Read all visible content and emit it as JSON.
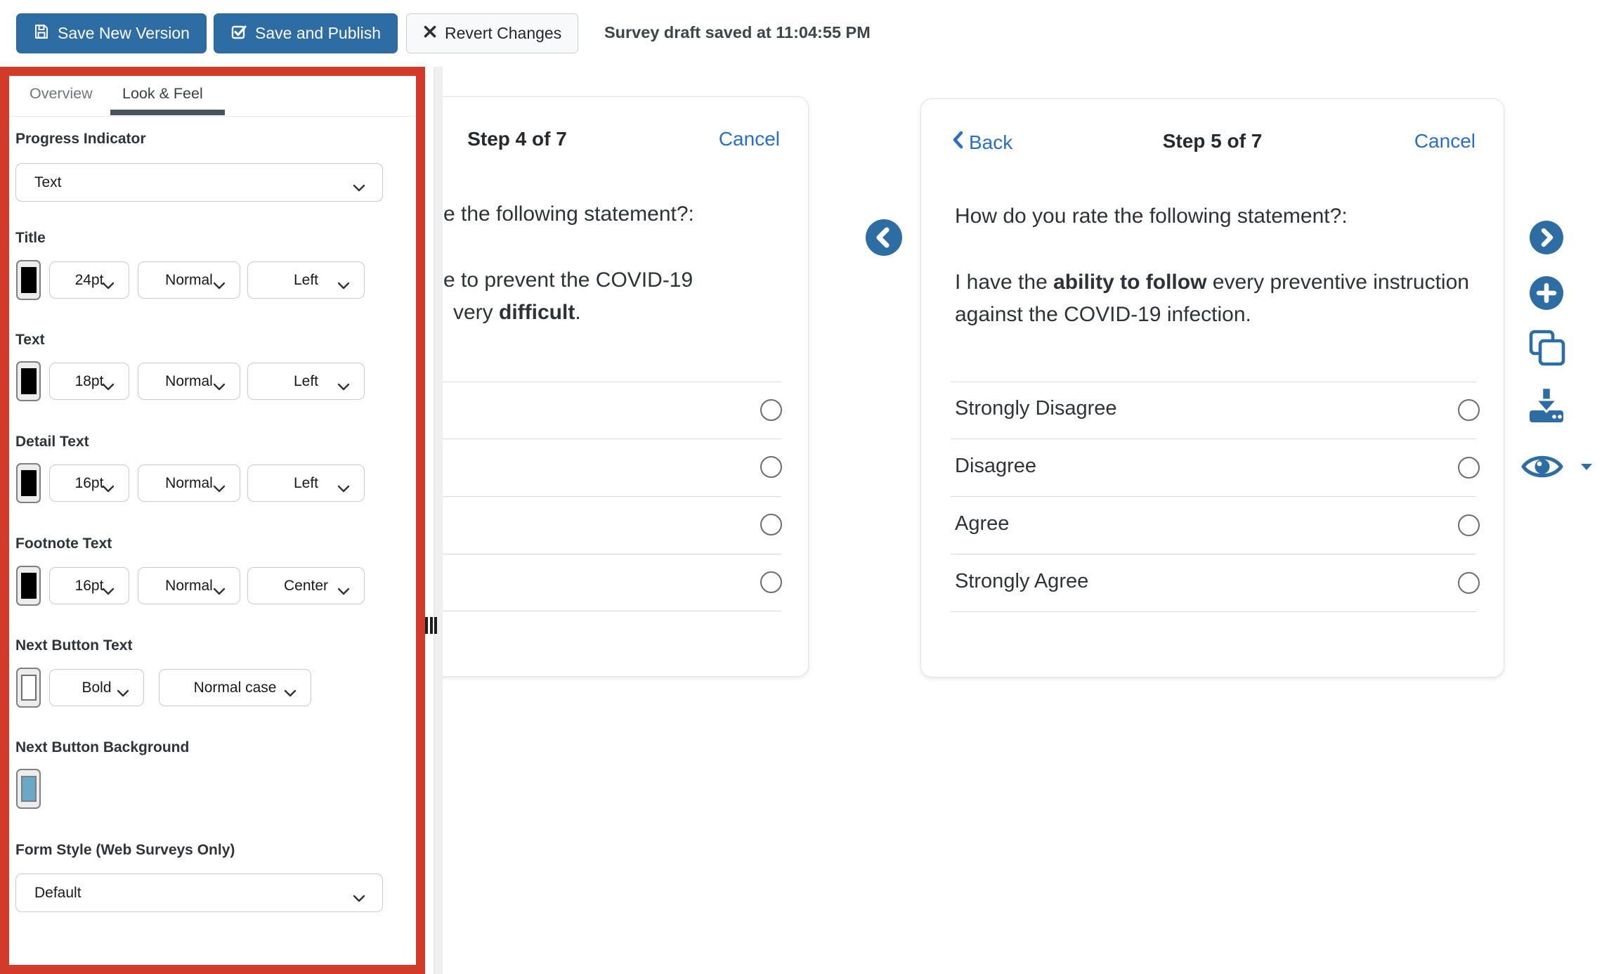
{
  "toolbar": {
    "save_new_version": "Save New Version",
    "save_and_publish": "Save and Publish",
    "revert_changes": "Revert Changes",
    "status": "Survey draft saved at 11:04:55 PM"
  },
  "sidebar": {
    "tabs": {
      "overview": "Overview",
      "look_feel": "Look & Feel"
    },
    "progress_indicator": {
      "label": "Progress Indicator",
      "value": "Text"
    },
    "title": {
      "label": "Title",
      "color": "#000000",
      "size": "24pt",
      "weight": "Normal",
      "align": "Left"
    },
    "text": {
      "label": "Text",
      "color": "#000000",
      "size": "18pt",
      "weight": "Normal",
      "align": "Left"
    },
    "detail_text": {
      "label": "Detail Text",
      "color": "#000000",
      "size": "16pt",
      "weight": "Normal",
      "align": "Left"
    },
    "footnote_text": {
      "label": "Footnote Text",
      "color": "#000000",
      "size": "16pt",
      "weight": "Normal",
      "align": "Center"
    },
    "next_button_text": {
      "label": "Next Button Text",
      "color": "#FFFFFF",
      "weight": "Bold",
      "case": "Normal case"
    },
    "next_button_background": {
      "label": "Next Button Background",
      "color": "#6BA8C8"
    },
    "form_style": {
      "label": "Form Style (Web Surveys Only)",
      "value": "Default"
    }
  },
  "preview": {
    "step4": {
      "title": "Step 4 of 7",
      "cancel": "Cancel",
      "question_fragment": "e the following statement?:",
      "statement_fragment_line1": "e to prevent the COVID-19",
      "statement_fragment_line2_pre": "very ",
      "statement_fragment_line2_bold": "difficult",
      "statement_fragment_line2_post": "."
    },
    "step5": {
      "back": "Back",
      "title": "Step 5 of 7",
      "cancel": "Cancel",
      "question": "How do you rate the following statement?:",
      "statement_pre": "I have the ",
      "statement_bold": "ability to follow",
      "statement_post": " every preventive instruction against the COVID-19 infection.",
      "options": [
        "Strongly Disagree",
        "Disagree",
        "Agree",
        "Strongly Agree"
      ]
    }
  },
  "side_toolbar": {
    "icons": [
      "next-step",
      "add-step",
      "duplicate-step",
      "download",
      "preview-eye"
    ]
  },
  "colors": {
    "accent_blue": "#2E6DA4",
    "link_blue": "#2B6FC5",
    "annotation_red": "#D23B29",
    "swatch_black": "#000000",
    "swatch_white": "#FFFFFF",
    "swatch_blue": "#6BA8C8"
  }
}
